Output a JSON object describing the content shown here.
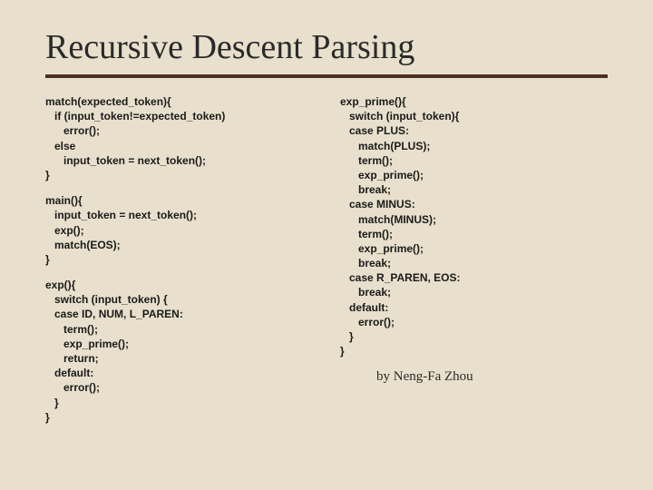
{
  "title": "Recursive Descent Parsing",
  "left": {
    "block1": "match(expected_token){\n   if (input_token!=expected_token)\n      error();\n   else\n      input_token = next_token();\n}",
    "block2": "main(){\n   input_token = next_token();\n   exp();\n   match(EOS);\n}",
    "block3": "exp(){\n   switch (input_token) {\n   case ID, NUM, L_PAREN:\n      term();\n      exp_prime();\n      return;\n   default:\n      error();\n   }\n}"
  },
  "right": {
    "block1": "exp_prime(){\n   switch (input_token){\n   case PLUS:\n      match(PLUS);\n      term();\n      exp_prime();\n      break;\n   case MINUS:\n      match(MINUS);\n      term();\n      exp_prime();\n      break;\n   case R_PAREN, EOS:\n      break;\n   default:\n      error();\n   }\n}"
  },
  "attribution": "by Neng-Fa Zhou"
}
